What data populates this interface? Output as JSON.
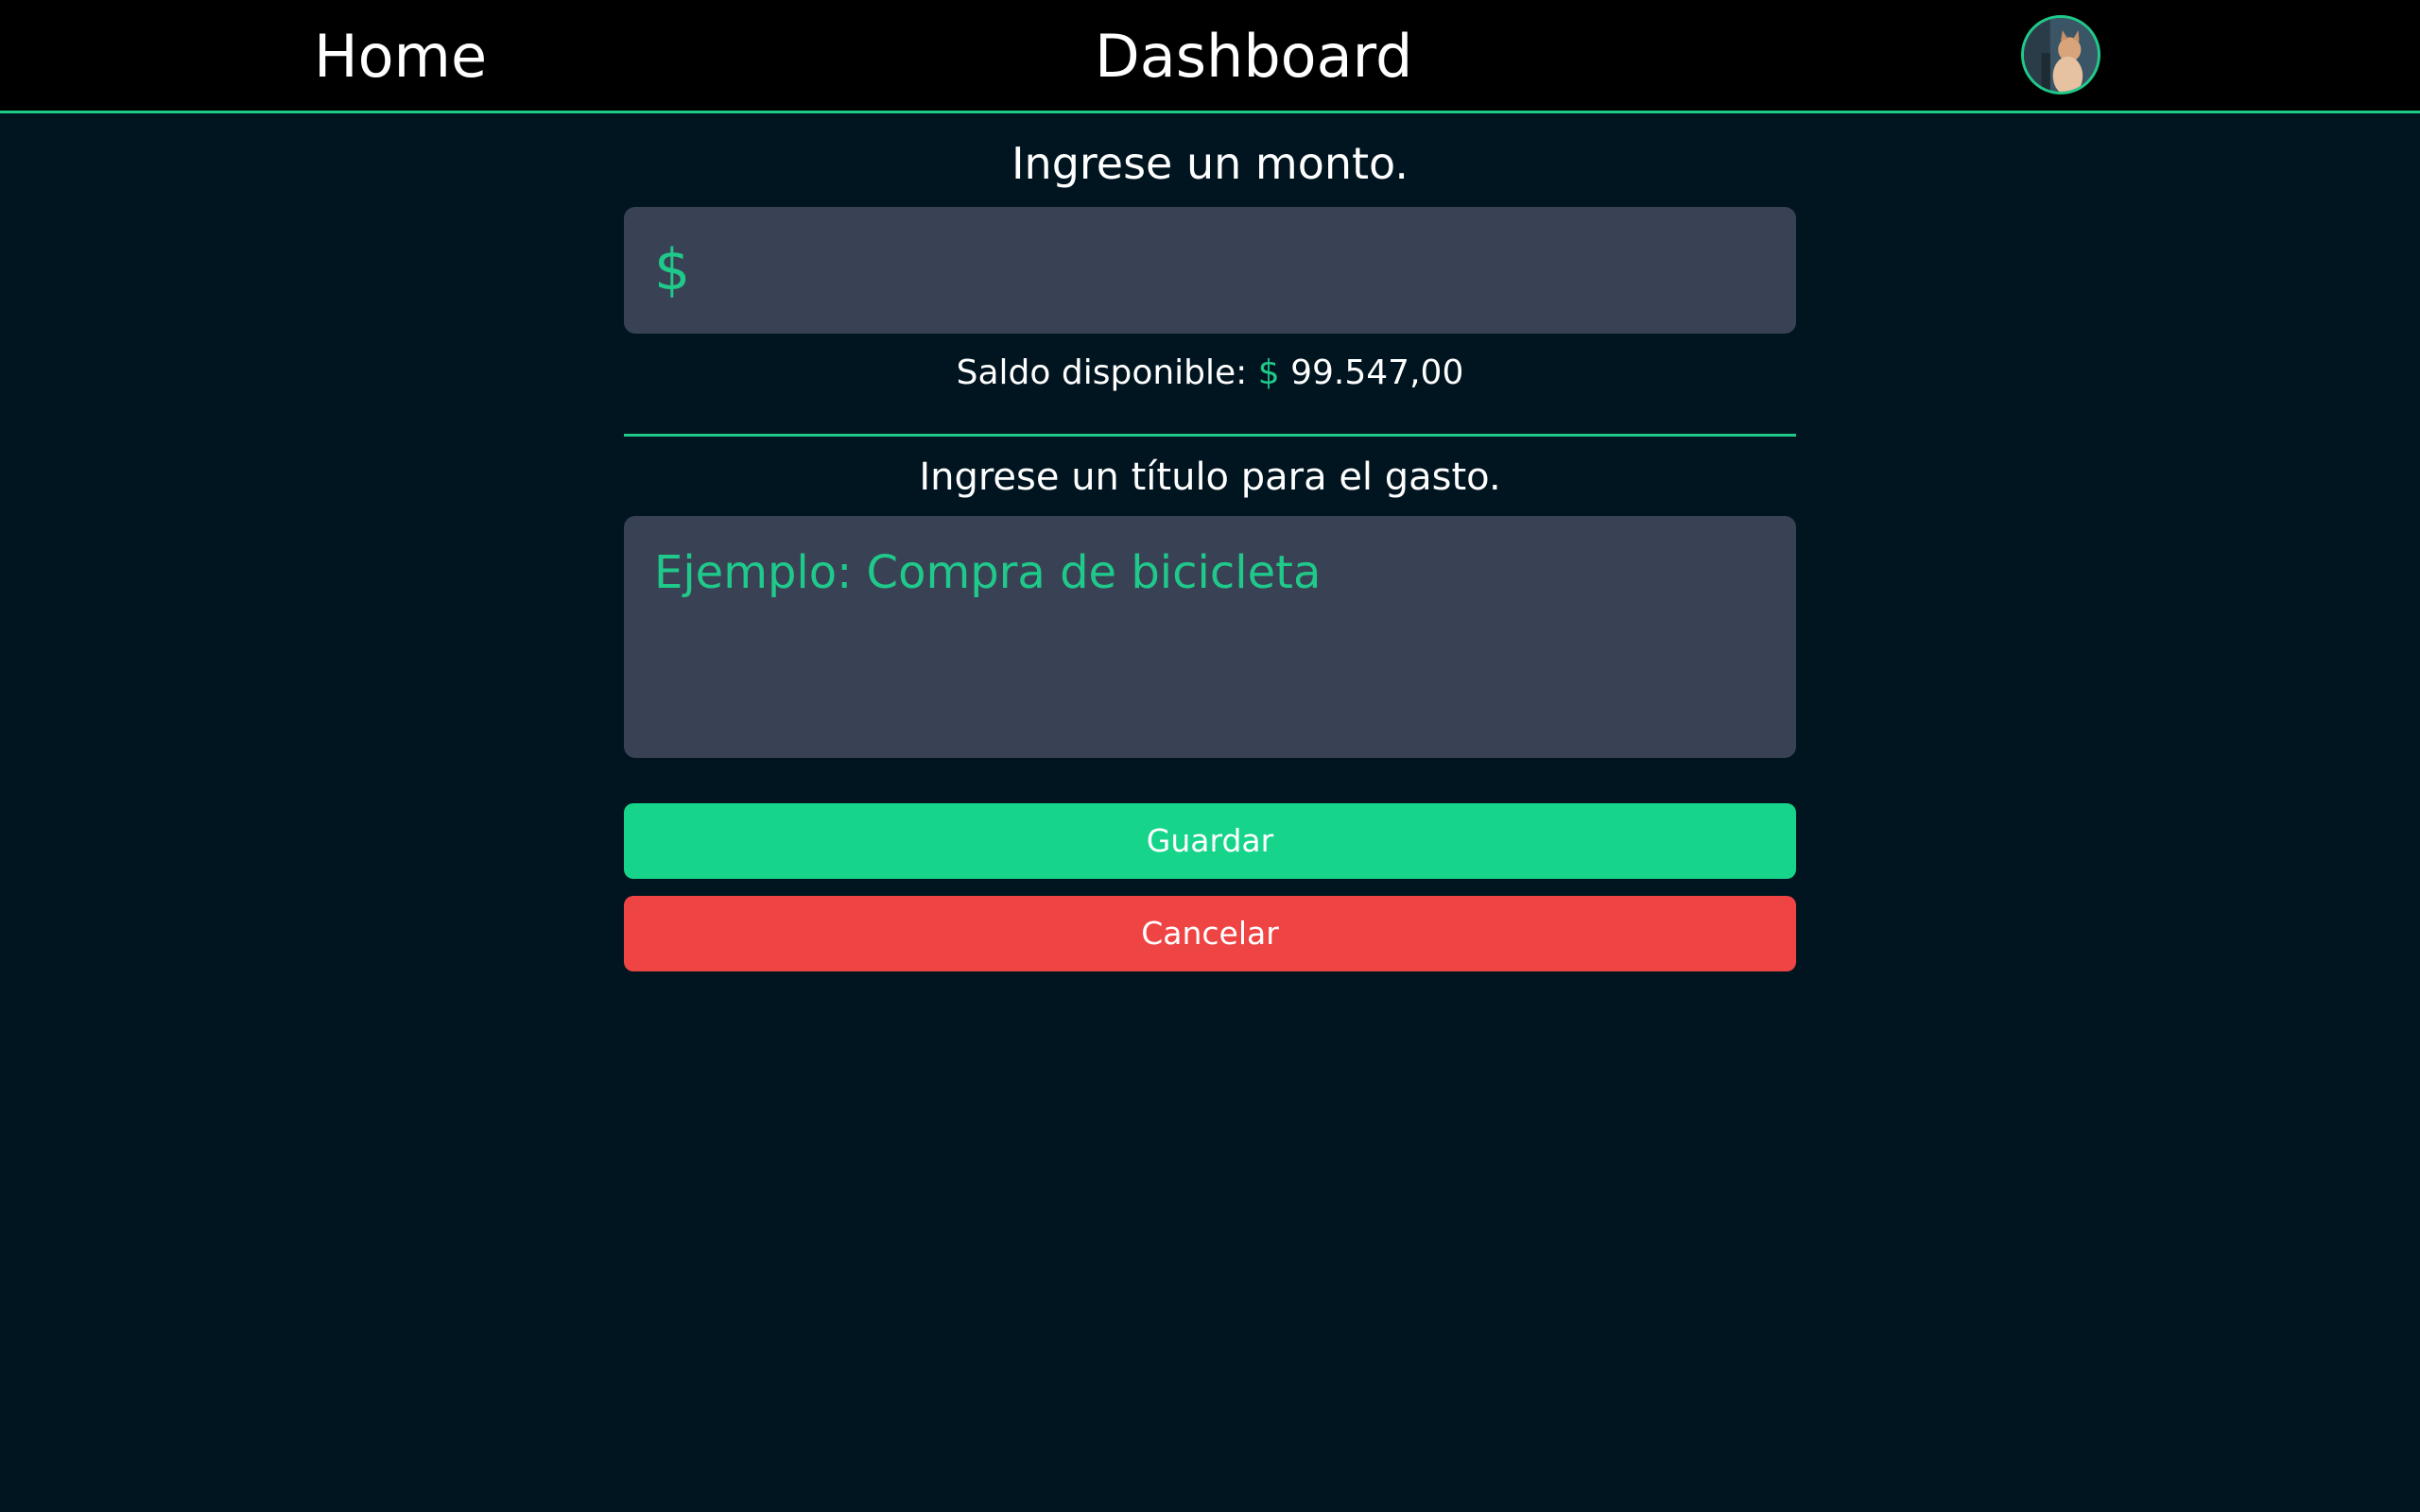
{
  "nav": {
    "home_label": "Home",
    "dashboard_label": "Dashboard",
    "avatar_icon": "user-avatar-photo"
  },
  "form": {
    "amount_label": "Ingrese un monto.",
    "currency_symbol": "$",
    "amount_value": "",
    "balance_label": "Saldo disponible:",
    "balance_currency": "$",
    "balance_value": "99.547,00",
    "title_label": "Ingrese un título para el gasto.",
    "title_placeholder": "Ejemplo: Compra de bicicleta",
    "save_label": "Guardar",
    "cancel_label": "Cancelar"
  },
  "colors": {
    "background": "#001520",
    "navbar": "#000000",
    "accent": "#1fc98a",
    "input_bg": "#394254",
    "save_button": "#16d48a",
    "cancel_button": "#ef4444"
  }
}
